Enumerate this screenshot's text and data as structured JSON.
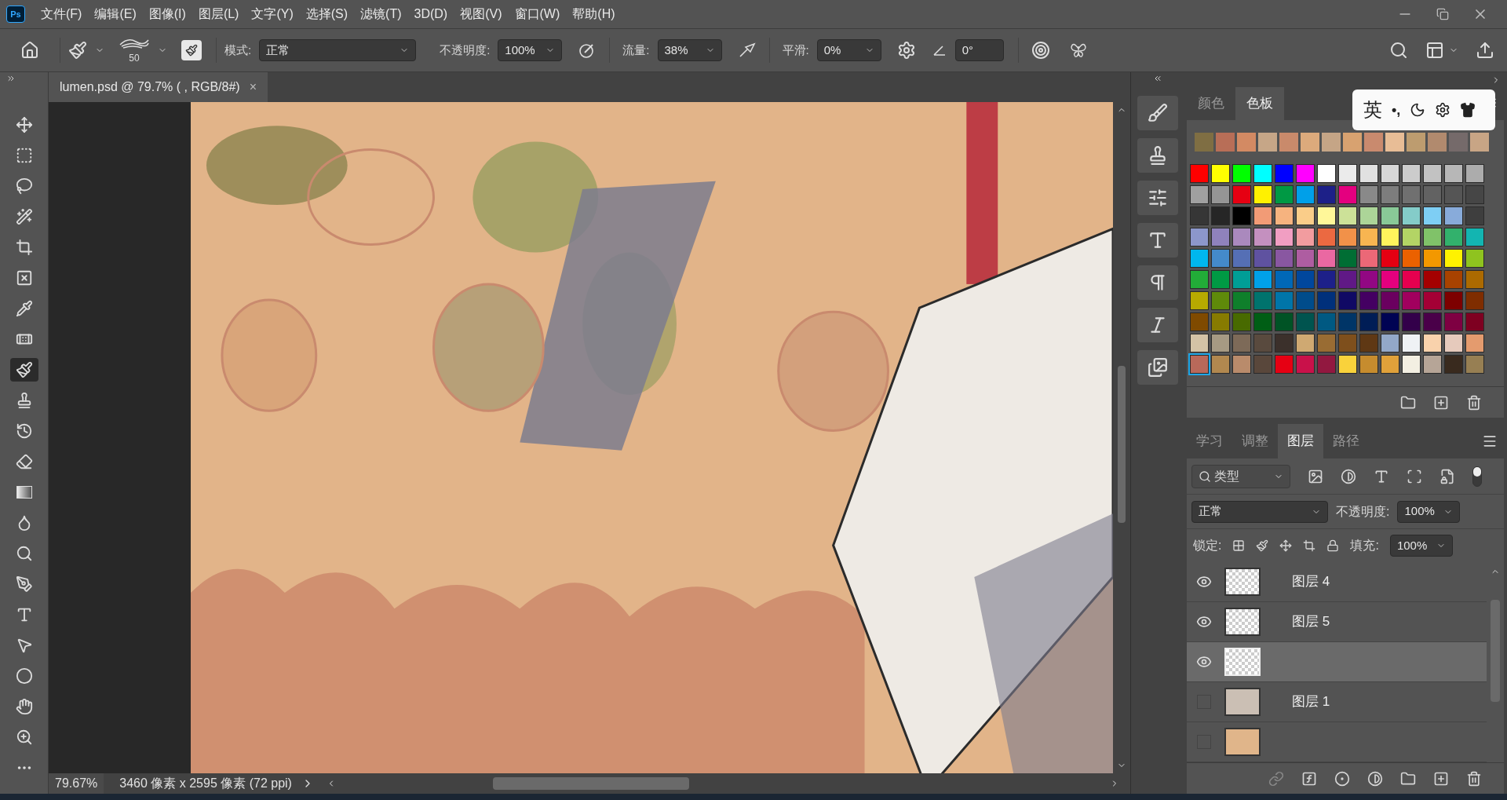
{
  "app_icon": "Ps",
  "menu": [
    "文件(F)",
    "编辑(E)",
    "图像(I)",
    "图层(L)",
    "文字(Y)",
    "选择(S)",
    "滤镜(T)",
    "3D(D)",
    "视图(V)",
    "窗口(W)",
    "帮助(H)"
  ],
  "options_bar": {
    "brush_size": "50",
    "mode_label": "模式:",
    "mode": "正常",
    "opacity_label": "不透明度:",
    "opacity": "100%",
    "flow_label": "流量:",
    "flow": "38%",
    "smoothing_label": "平滑:",
    "smoothing": "0%",
    "angle": "0°"
  },
  "document_tab": {
    "title": "lumen.psd @ 79.7% ( , RGB/8#)",
    "close": "×"
  },
  "tools": [
    {
      "kind": "move",
      "selected": false
    },
    {
      "kind": "marquee",
      "selected": false
    },
    {
      "kind": "lasso",
      "selected": false
    },
    {
      "kind": "wand",
      "selected": false
    },
    {
      "kind": "crop",
      "selected": false
    },
    {
      "kind": "frame",
      "selected": false
    },
    {
      "kind": "eyedropper",
      "selected": false
    },
    {
      "kind": "heal",
      "selected": false
    },
    {
      "kind": "brush",
      "selected": true
    },
    {
      "kind": "stamp",
      "selected": false
    },
    {
      "kind": "history",
      "selected": false
    },
    {
      "kind": "eraser",
      "selected": false
    },
    {
      "kind": "gradient",
      "selected": false
    },
    {
      "kind": "blur",
      "selected": false
    },
    {
      "kind": "dodge",
      "selected": false
    },
    {
      "kind": "pen",
      "selected": false
    },
    {
      "kind": "type",
      "selected": false
    },
    {
      "kind": "select",
      "selected": false
    },
    {
      "kind": "ellipse",
      "selected": false
    },
    {
      "kind": "hand",
      "selected": false
    },
    {
      "kind": "zoom",
      "selected": false
    },
    {
      "kind": "more",
      "selected": false
    }
  ],
  "swatches_panel": {
    "tabs": [
      {
        "label": "颜色",
        "selected": false
      },
      {
        "label": "色板",
        "selected": true
      }
    ],
    "recent": [
      {
        "color": "#7f6e43"
      },
      {
        "color": "#b86e57"
      },
      {
        "color": "#d38a63"
      },
      {
        "color": "#c6a687"
      },
      {
        "color": "#c98a6b"
      },
      {
        "color": "#dcaa7c"
      },
      {
        "color": "#c5a586"
      },
      {
        "color": "#d8a270"
      },
      {
        "color": "#c98a6e"
      },
      {
        "color": "#e8bd96"
      },
      {
        "color": "#bd9c6f"
      },
      {
        "color": "#b18a6e"
      },
      {
        "color": "#756a6a"
      },
      {
        "color": "#c8a585"
      }
    ],
    "swatches": [
      {
        "color": "#ff0000",
        "selected": false
      },
      {
        "color": "#ffff00",
        "selected": false
      },
      {
        "color": "#00ff00",
        "selected": false
      },
      {
        "color": "#00ffff",
        "selected": false
      },
      {
        "color": "#0000ff",
        "selected": false
      },
      {
        "color": "#ff00ff",
        "selected": false
      },
      {
        "color": "#ffffff",
        "selected": false
      },
      {
        "color": "#ebebeb",
        "selected": false
      },
      {
        "color": "#e1e1e1",
        "selected": false
      },
      {
        "color": "#d7d7d7",
        "selected": false
      },
      {
        "color": "#cccccc",
        "selected": false
      },
      {
        "color": "#c2c2c2",
        "selected": false
      },
      {
        "color": "#b7b7b7",
        "selected": false
      },
      {
        "color": "#acacac",
        "selected": false
      },
      {
        "color": "#a0a0a0",
        "selected": false
      },
      {
        "color": "#959595",
        "selected": false
      },
      {
        "color": "#e60012",
        "selected": false
      },
      {
        "color": "#fff100",
        "selected": false
      },
      {
        "color": "#009944",
        "selected": false
      },
      {
        "color": "#00a0e9",
        "selected": false
      },
      {
        "color": "#1d2088",
        "selected": false
      },
      {
        "color": "#e4007f",
        "selected": false
      },
      {
        "color": "#898989",
        "selected": false
      },
      {
        "color": "#7d7d7d",
        "selected": false
      },
      {
        "color": "#707070",
        "selected": false
      },
      {
        "color": "#626262",
        "selected": false
      },
      {
        "color": "#555555",
        "selected": false
      },
      {
        "color": "#464646",
        "selected": false
      },
      {
        "color": "#363636",
        "selected": false
      },
      {
        "color": "#262626",
        "selected": false
      },
      {
        "color": "#000000",
        "selected": false
      },
      {
        "color": "#f29b76",
        "selected": false
      },
      {
        "color": "#f6b37f",
        "selected": false
      },
      {
        "color": "#facd89",
        "selected": false
      },
      {
        "color": "#fff799",
        "selected": false
      },
      {
        "color": "#cce198",
        "selected": false
      },
      {
        "color": "#acd598",
        "selected": false
      },
      {
        "color": "#89c997",
        "selected": false
      },
      {
        "color": "#84ccc9",
        "selected": false
      },
      {
        "color": "#7ecef4",
        "selected": false
      },
      {
        "color": "#88abda",
        "selected": false
      },
      {
        "color": "#3e3e3e",
        "selected": false
      },
      {
        "color": "#8c97cb",
        "selected": false
      },
      {
        "color": "#8f82bc",
        "selected": false
      },
      {
        "color": "#aa89bd",
        "selected": false
      },
      {
        "color": "#c490bf",
        "selected": false
      },
      {
        "color": "#f19ec2",
        "selected": false
      },
      {
        "color": "#f29c9f",
        "selected": false
      },
      {
        "color": "#eb6941",
        "selected": false
      },
      {
        "color": "#f19149",
        "selected": false
      },
      {
        "color": "#f8b551",
        "selected": false
      },
      {
        "color": "#fff45c",
        "selected": false
      },
      {
        "color": "#b3d465",
        "selected": false
      },
      {
        "color": "#80c269",
        "selected": false
      },
      {
        "color": "#32b16c",
        "selected": false
      },
      {
        "color": "#13b5b1",
        "selected": false
      },
      {
        "color": "#00b7ee",
        "selected": false
      },
      {
        "color": "#448aca",
        "selected": false
      },
      {
        "color": "#556fb5",
        "selected": false
      },
      {
        "color": "#5f52a0",
        "selected": false
      },
      {
        "color": "#8957a1",
        "selected": false
      },
      {
        "color": "#ae5da1",
        "selected": false
      },
      {
        "color": "#ea68a2",
        "selected": false
      },
      {
        "color": "#006e34",
        "selected": false
      },
      {
        "color": "#eb6877",
        "selected": false
      },
      {
        "color": "#e50012",
        "selected": false
      },
      {
        "color": "#eb6100",
        "selected": false
      },
      {
        "color": "#f39800",
        "selected": false
      },
      {
        "color": "#fff200",
        "selected": false
      },
      {
        "color": "#8fc31f",
        "selected": false
      },
      {
        "color": "#22ac38",
        "selected": false
      },
      {
        "color": "#009a44",
        "selected": false
      },
      {
        "color": "#009e96",
        "selected": false
      },
      {
        "color": "#00a1e9",
        "selected": false
      },
      {
        "color": "#0068b7",
        "selected": false
      },
      {
        "color": "#00479d",
        "selected": false
      },
      {
        "color": "#1d2089",
        "selected": false
      },
      {
        "color": "#601986",
        "selected": false
      },
      {
        "color": "#920783",
        "selected": false
      },
      {
        "color": "#e4007e",
        "selected": false
      },
      {
        "color": "#e5004f",
        "selected": false
      },
      {
        "color": "#a40000",
        "selected": false
      },
      {
        "color": "#a84200",
        "selected": false
      },
      {
        "color": "#ac6a00",
        "selected": false
      },
      {
        "color": "#b7aa00",
        "selected": false
      },
      {
        "color": "#5f8a0a",
        "selected": false
      },
      {
        "color": "#0f7f2b",
        "selected": false
      },
      {
        "color": "#00736d",
        "selected": false
      },
      {
        "color": "#0075a9",
        "selected": false
      },
      {
        "color": "#004c8b",
        "selected": false
      },
      {
        "color": "#00307b",
        "selected": false
      },
      {
        "color": "#100964",
        "selected": false
      },
      {
        "color": "#440062",
        "selected": false
      },
      {
        "color": "#6a005f",
        "selected": false
      },
      {
        "color": "#a1005e",
        "selected": false
      },
      {
        "color": "#a40035",
        "selected": false
      },
      {
        "color": "#7d0000",
        "selected": false
      },
      {
        "color": "#7f2d00",
        "selected": false
      },
      {
        "color": "#7f4a00",
        "selected": false
      },
      {
        "color": "#877b00",
        "selected": false
      },
      {
        "color": "#486a00",
        "selected": false
      },
      {
        "color": "#005e15",
        "selected": false
      },
      {
        "color": "#005325",
        "selected": false
      },
      {
        "color": "#00544f",
        "selected": false
      },
      {
        "color": "#005982",
        "selected": false
      },
      {
        "color": "#003567",
        "selected": false
      },
      {
        "color": "#001d56",
        "selected": false
      },
      {
        "color": "#000353",
        "selected": false
      },
      {
        "color": "#33004a",
        "selected": false
      },
      {
        "color": "#4a0049",
        "selected": false
      },
      {
        "color": "#7e0042",
        "selected": false
      },
      {
        "color": "#7e0021",
        "selected": false
      },
      {
        "color": "#d3c3a6",
        "selected": false
      },
      {
        "color": "#a69a83",
        "selected": false
      },
      {
        "color": "#7d6a58",
        "selected": false
      },
      {
        "color": "#594a3e",
        "selected": false
      },
      {
        "color": "#3b302b",
        "selected": false
      },
      {
        "color": "#cfa972",
        "selected": false
      },
      {
        "color": "#996c33",
        "selected": false
      },
      {
        "color": "#7e4f1c",
        "selected": false
      },
      {
        "color": "#5f3814",
        "selected": false
      },
      {
        "color": "#93a8c8",
        "selected": false
      },
      {
        "color": "#eff2f5",
        "selected": false
      },
      {
        "color": "#f9d2ac",
        "selected": false
      },
      {
        "color": "#e6cabc",
        "selected": false
      },
      {
        "color": "#e49b6e",
        "selected": false
      },
      {
        "color": "#b8695a",
        "selected": true
      },
      {
        "color": "#b1884f",
        "selected": false
      },
      {
        "color": "#b98b6b",
        "selected": false
      },
      {
        "color": "#59473b",
        "selected": false
      },
      {
        "color": "#e60013",
        "selected": false
      },
      {
        "color": "#c9114a",
        "selected": false
      },
      {
        "color": "#921840",
        "selected": false
      },
      {
        "color": "#f9d23b",
        "selected": false
      },
      {
        "color": "#c68c2e",
        "selected": false
      },
      {
        "color": "#e0a13a",
        "selected": false
      },
      {
        "color": "#f3efe2",
        "selected": false
      },
      {
        "color": "#b6a597",
        "selected": false
      },
      {
        "color": "#392a1e",
        "selected": false
      },
      {
        "color": "#977f53",
        "selected": false
      }
    ]
  },
  "ime_toolbar": {
    "language": "英",
    "punctuation": "•,"
  },
  "layers_panel": {
    "tabs": [
      {
        "label": "学习",
        "selected": false
      },
      {
        "label": "调整",
        "selected": false
      },
      {
        "label": "图层",
        "selected": true
      },
      {
        "label": "路径",
        "selected": false
      }
    ],
    "filter": "类型",
    "blend_mode": "正常",
    "opacity_label": "不透明度:",
    "opacity": "100%",
    "lock_label": "锁定:",
    "fill_label": "填充:",
    "fill": "100%",
    "layers": [
      {
        "name": "图层 4",
        "visible": true,
        "selected": false,
        "kind": "transparent"
      },
      {
        "name": "图层 5",
        "visible": true,
        "selected": false,
        "kind": "transparent"
      },
      {
        "visible": true,
        "selected": true,
        "kind": "transparent"
      },
      {
        "name": "图层 1",
        "visible": false,
        "selected": false,
        "kind": "photo"
      },
      {
        "visible": false,
        "selected": false,
        "kind": "fill"
      }
    ]
  },
  "status_bar": {
    "zoom": "79.67%",
    "document_size": "3460 像素 x 2595 像素 (72 ppi)"
  }
}
